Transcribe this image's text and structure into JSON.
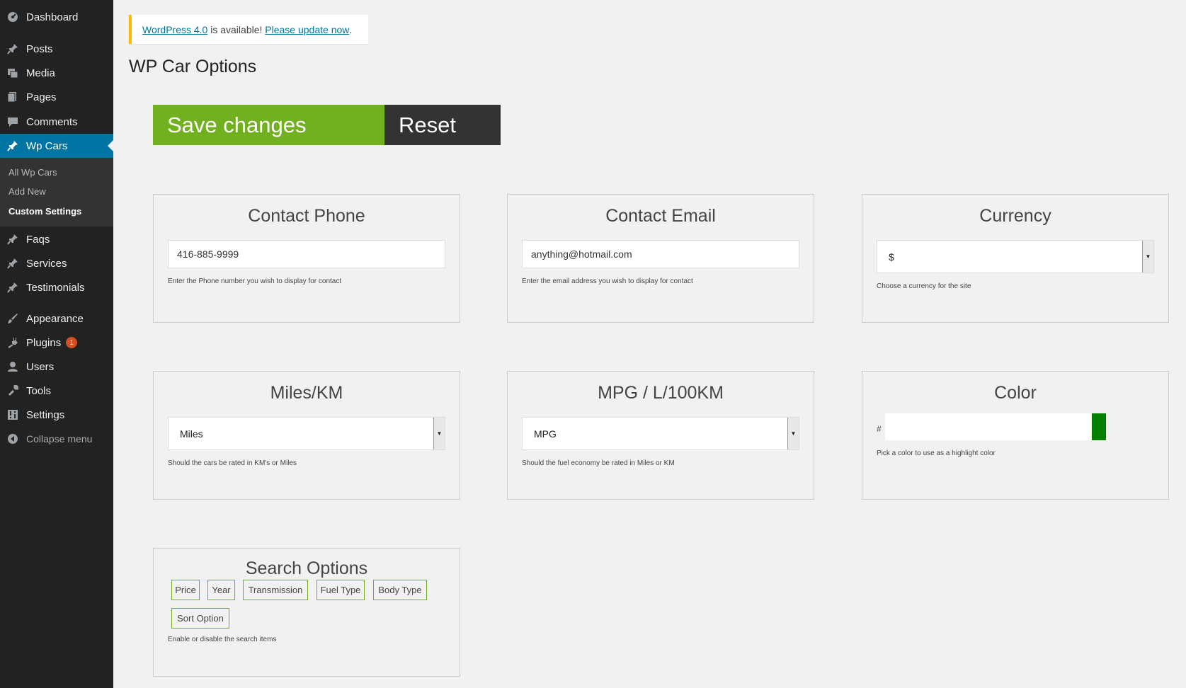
{
  "sidebar": {
    "items": [
      {
        "label": "Dashboard",
        "icon": "dashboard-icon"
      },
      {
        "label": "Posts",
        "icon": "pin-icon"
      },
      {
        "label": "Media",
        "icon": "media-icon"
      },
      {
        "label": "Pages",
        "icon": "pages-icon"
      },
      {
        "label": "Comments",
        "icon": "comments-icon"
      },
      {
        "label": "Wp Cars",
        "icon": "pin-icon"
      },
      {
        "label": "Faqs",
        "icon": "pin-icon"
      },
      {
        "label": "Services",
        "icon": "pin-icon"
      },
      {
        "label": "Testimonials",
        "icon": "pin-icon"
      },
      {
        "label": "Appearance",
        "icon": "brush-icon"
      },
      {
        "label": "Plugins",
        "icon": "plugin-icon",
        "badge": "1"
      },
      {
        "label": "Users",
        "icon": "user-icon"
      },
      {
        "label": "Tools",
        "icon": "wrench-icon"
      },
      {
        "label": "Settings",
        "icon": "settings-icon"
      }
    ],
    "submenu": [
      "All Wp Cars",
      "Add New",
      "Custom Settings"
    ],
    "collapse_label": "Collapse menu",
    "active_color": "#0074a2",
    "background": "#222222"
  },
  "notice": {
    "link_version": "WordPress 4.0",
    "text_middle": " is available! ",
    "link_update": "Please update now",
    "text_end": ".",
    "accent": "#ffba00"
  },
  "page_title": "WP Car Options",
  "buttons": {
    "save": "Save changes",
    "reset": "Reset",
    "save_color": "#71b01f",
    "reset_color": "#333333"
  },
  "cards": {
    "phone": {
      "title": "Contact Phone",
      "value": "416-885-9999",
      "help": "Enter the Phone number you wish to display for contact"
    },
    "email": {
      "title": "Contact Email",
      "value": "anything@hotmail.com",
      "help": "Enter the email address you wish to display for contact"
    },
    "currency": {
      "title": "Currency",
      "value": "$",
      "help": "Choose a currency for the site"
    },
    "miles": {
      "title": "Miles/KM",
      "value": "Miles",
      "help": "Should the cars be rated in KM's or Miles"
    },
    "mpg": {
      "title": "MPG / L/100KM",
      "value": "MPG",
      "help": "Should the fuel economy be rated in Miles or KM"
    },
    "color": {
      "title": "Color",
      "hash": "#",
      "value": "",
      "swatch": "#007f00",
      "help": "Pick a color to use as a highlight color"
    },
    "search": {
      "title": "Search Options",
      "chips": [
        "Price",
        "Year",
        "Transmission",
        "Fuel Type",
        "Body Type",
        "Sort Option"
      ],
      "help": "Enable or disable the search items"
    }
  }
}
